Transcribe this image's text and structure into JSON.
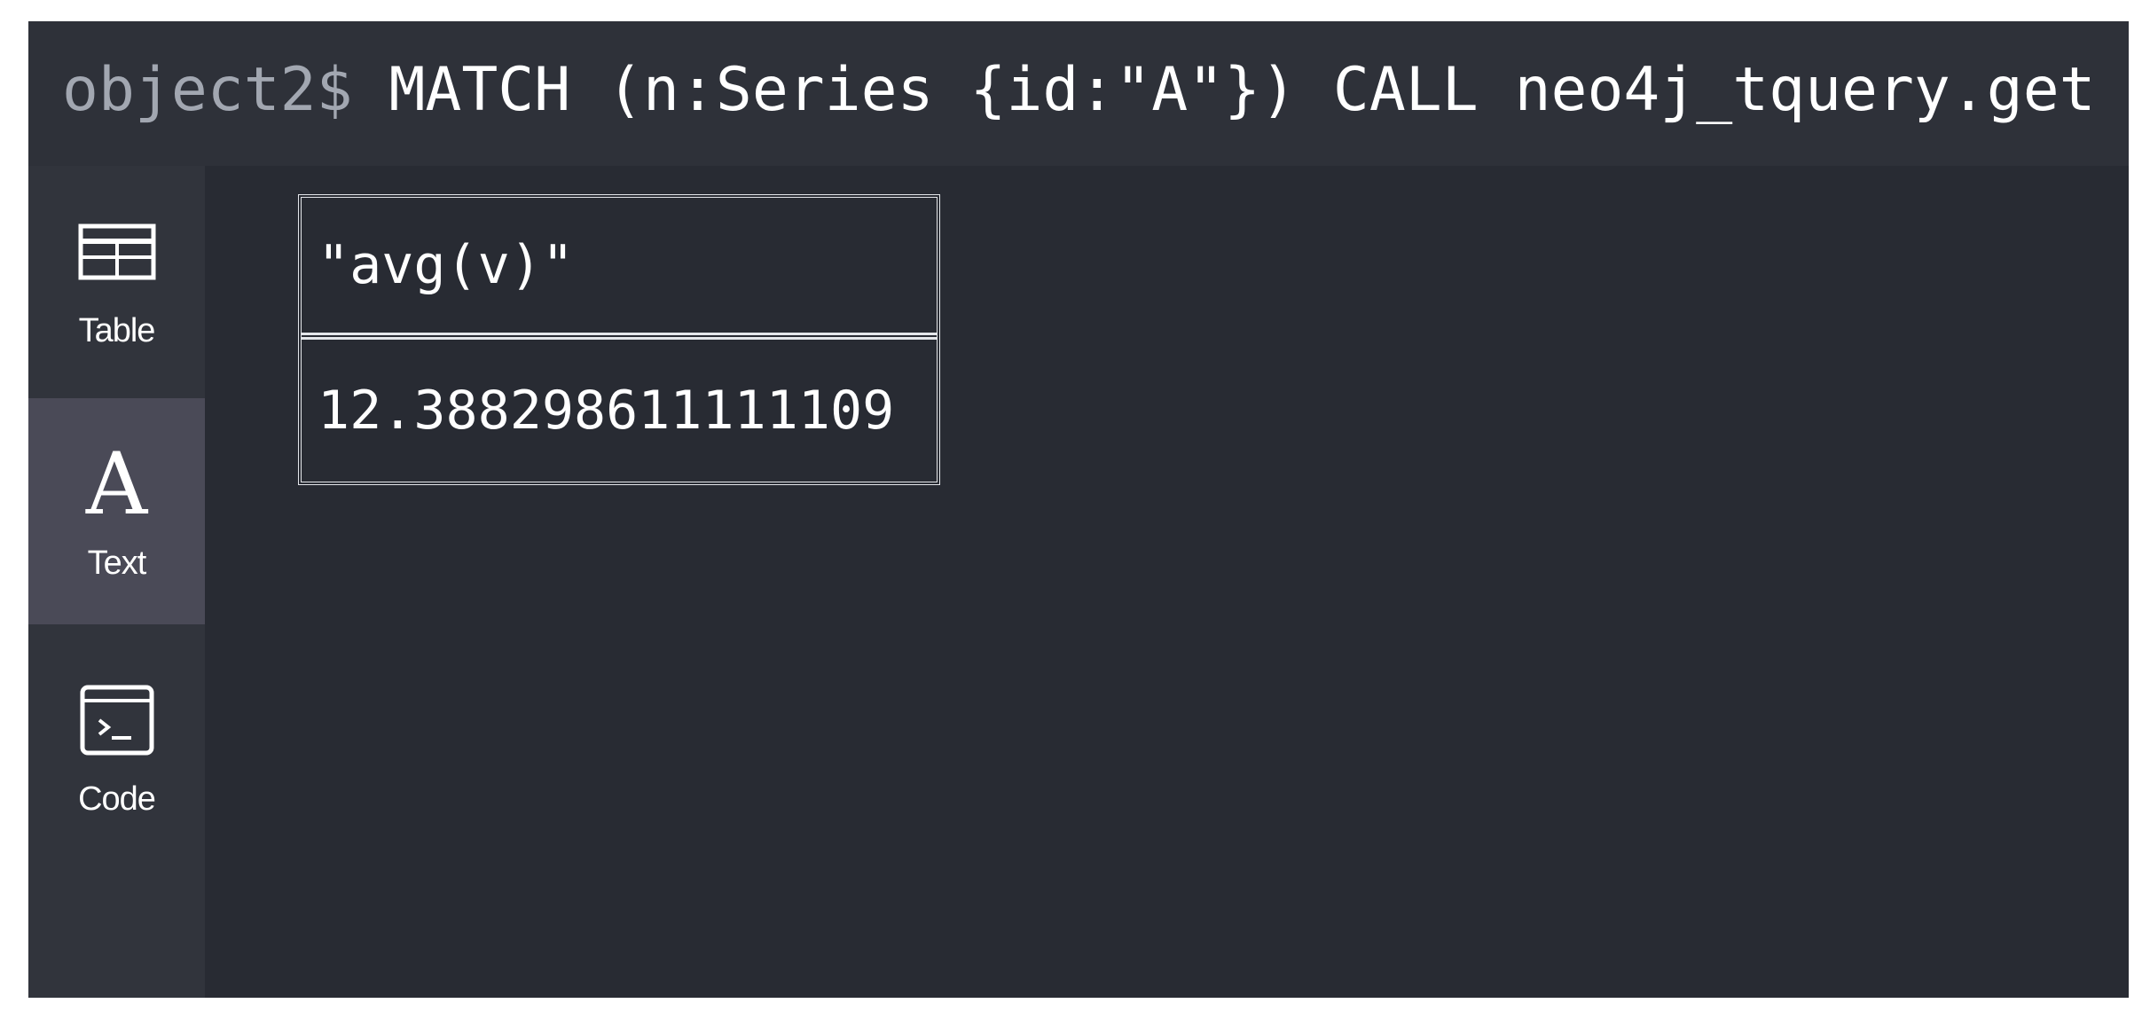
{
  "command": {
    "prompt": "object2$",
    "query": "MATCH (n:Series {id:\"A\"}) CALL neo4j_tquery.get"
  },
  "sidebar": {
    "items": [
      {
        "label": "Table",
        "icon": "table-icon",
        "active": false
      },
      {
        "label": "Text",
        "icon": "text-icon",
        "active": true
      },
      {
        "label": "Code",
        "icon": "code-icon",
        "active": false
      }
    ]
  },
  "result": {
    "column": "\"avg(v)\"",
    "value": "12.388298611111109"
  },
  "colors": {
    "background": "#282b33",
    "command_bar": "#2e3139",
    "sidebar": "#31343c",
    "active_item": "#4a4a57",
    "prompt_text": "#a2a7b1",
    "text": "#ffffff"
  }
}
